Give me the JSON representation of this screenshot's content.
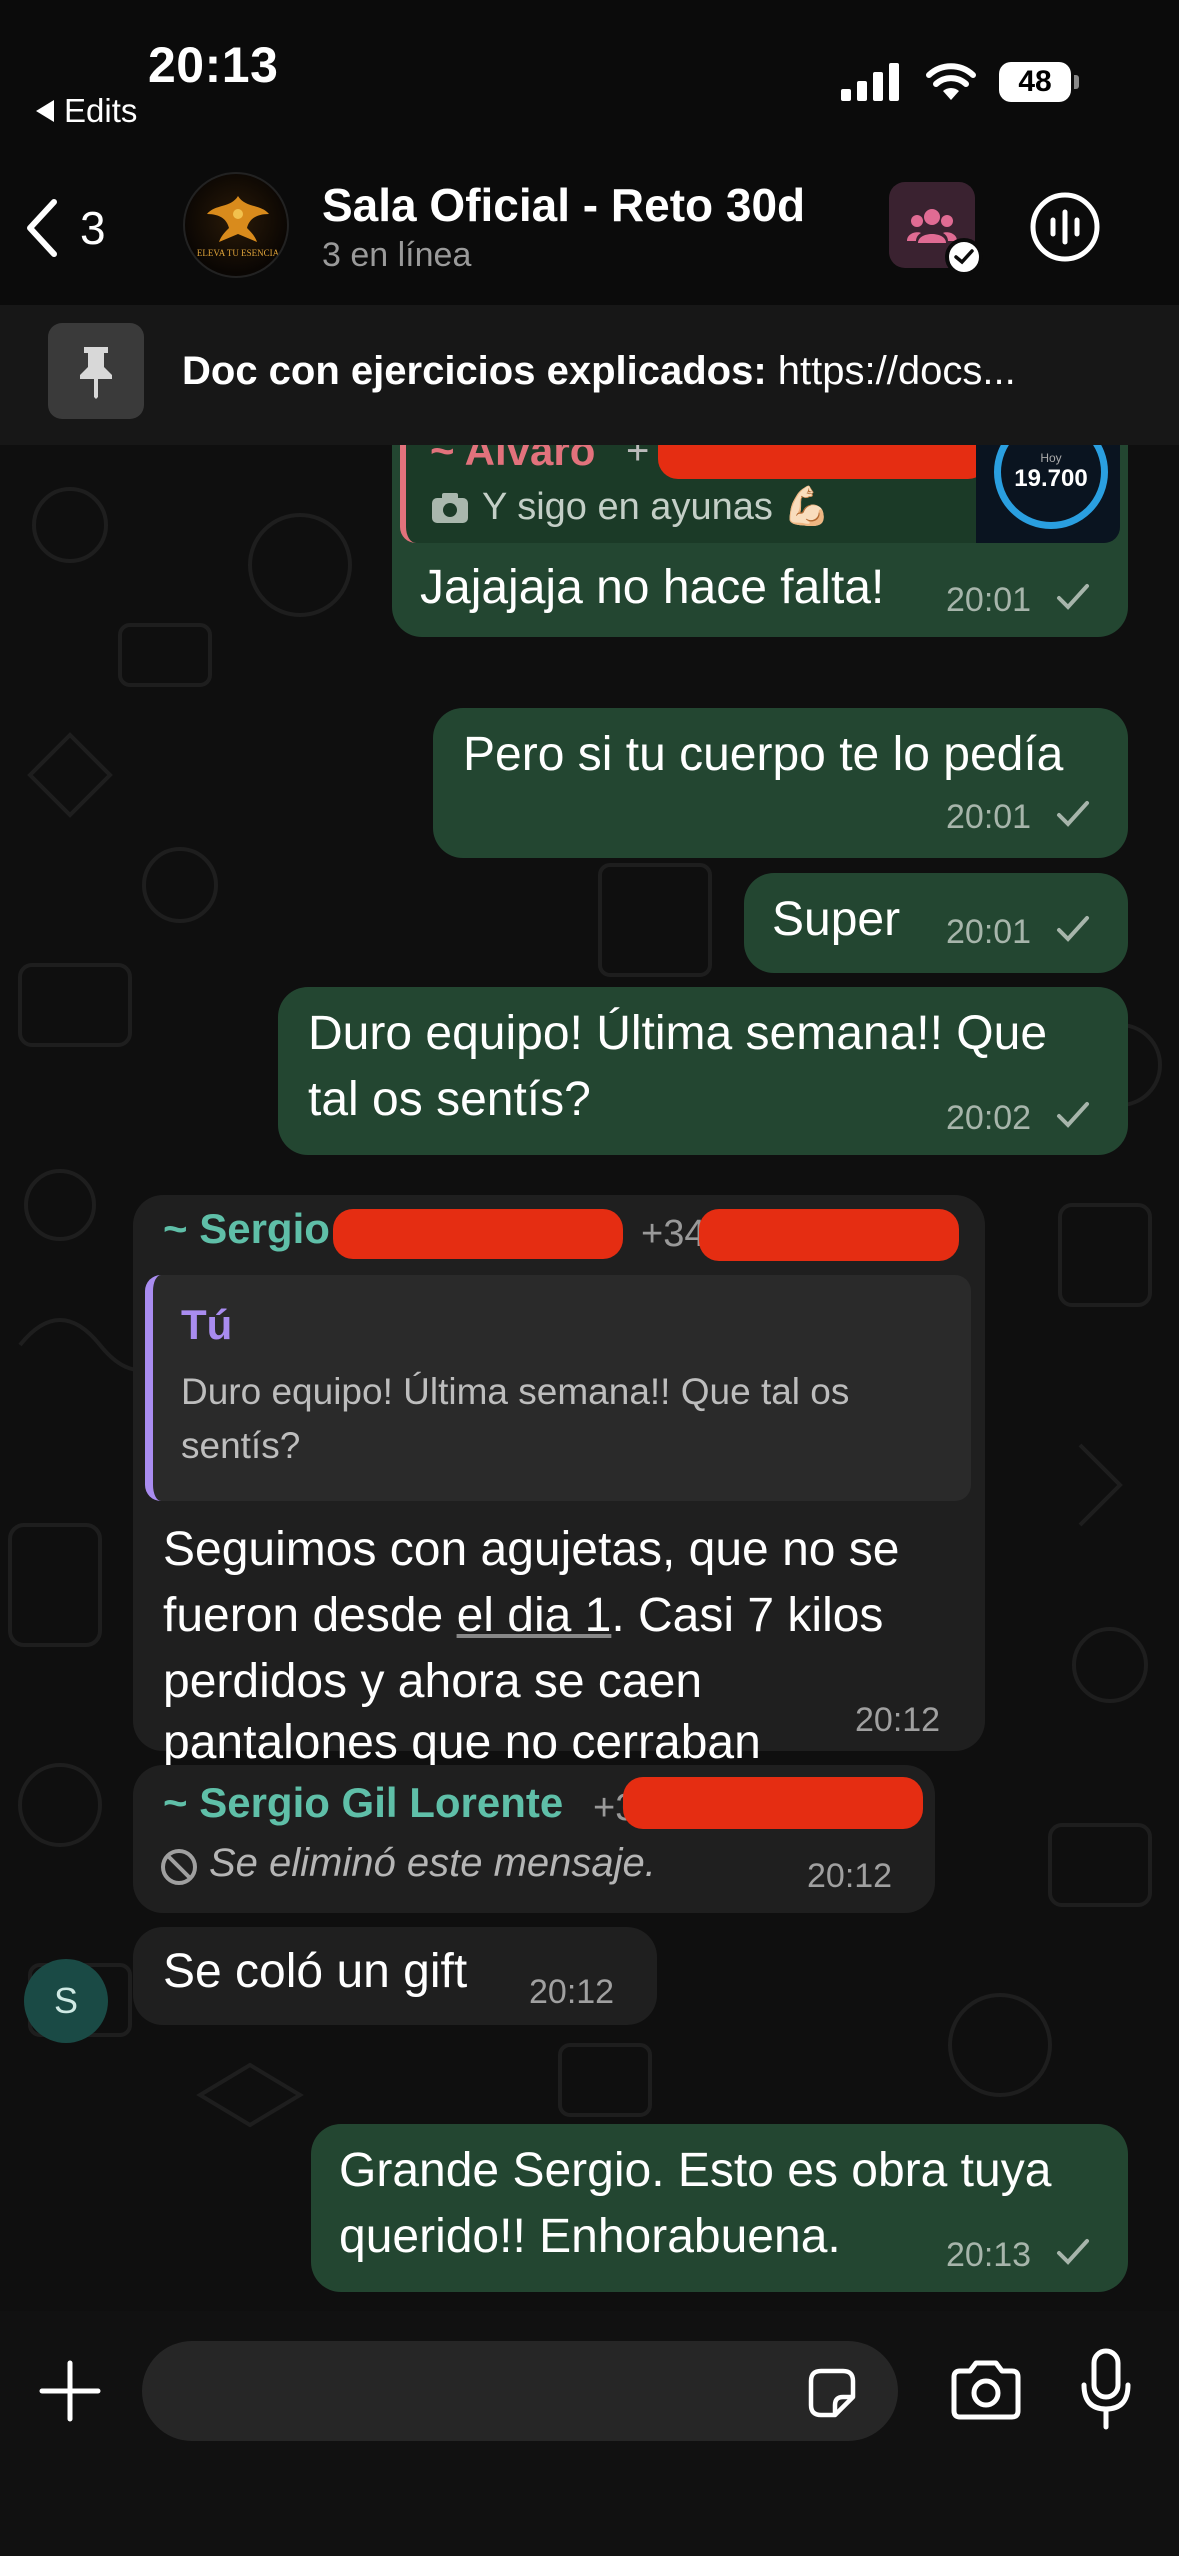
{
  "status_bar": {
    "time": "20:13",
    "back_app": "Edits",
    "battery": "48"
  },
  "header": {
    "back_count": "3",
    "title": "Sala Oficial - Reto 30d",
    "subtitle": "3 en línea",
    "avatar_text": "ELEVA TU ESENCIA"
  },
  "pinned": {
    "label": "Doc con ejercicios explicados:",
    "value": "https://docs..."
  },
  "messages": {
    "m1": {
      "quote_sender": "~ Alvaro",
      "quote_phone_prefix": "+",
      "quote_text": "Y sigo en ayunas 💪🏻",
      "thumb_value": "19.700",
      "thumb_label": "Hoy",
      "text": "Jajajaja no hace falta!",
      "time": "20:01"
    },
    "m2": {
      "text": "Pero si tu cuerpo te lo pedía",
      "time": "20:01"
    },
    "m3": {
      "text": "Super",
      "time": "20:01"
    },
    "m4": {
      "line1": "Duro equipo! Última semana!! Que",
      "line2": "tal os sentís?",
      "time": "20:02"
    },
    "m5": {
      "sender": "~ Sergio",
      "phone": "+34",
      "quote_sender": "Tú",
      "quote_line1": "Duro equipo! Última semana!! Que tal os",
      "quote_line2": "sentís?",
      "line1": "Seguimos con agujetas, que no se",
      "line2a": "fueron desde ",
      "line2b": "el dia 1",
      "line2c": ". Casi 7 kilos",
      "line3": "perdidos y ahora se caen",
      "line4": "pantalones que no cerraban",
      "time": "20:12"
    },
    "m6": {
      "sender": "~ Sergio Gil Lorente",
      "phone": "+3",
      "text": "Se eliminó este mensaje.",
      "time": "20:12"
    },
    "m7": {
      "avatar_letter": "S",
      "text": "Se coló un gift",
      "time": "20:12"
    },
    "m8": {
      "line1": "Grande Sergio. Esto es obra tuya",
      "line2": "querido!! Enhorabuena.",
      "time": "20:13"
    }
  },
  "input": {
    "placeholder": ""
  },
  "colors": {
    "outgoing": "#234631",
    "incoming": "#1f1f1f",
    "sergio_name": "#5fbfa8",
    "alvaro_name": "#e2727c",
    "you_name": "#a98cf0"
  }
}
